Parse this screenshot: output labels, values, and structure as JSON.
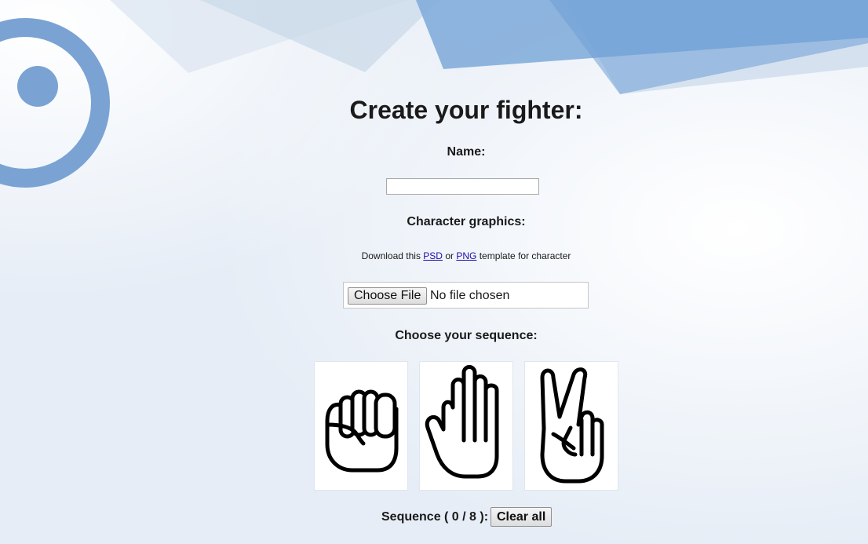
{
  "page": {
    "title": "Create your fighter:"
  },
  "form": {
    "name_label": "Name:",
    "name_value": "",
    "graphics_label": "Character graphics:",
    "download_prefix": "Download this",
    "psd_link": "PSD",
    "download_or": "or",
    "png_link": "PNG",
    "download_suffix": "template for character",
    "file_button_label": "Choose File",
    "file_status": "No file chosen",
    "sequence_label": "Choose your sequence:",
    "hands": [
      {
        "name": "rock",
        "icon": "fist-icon"
      },
      {
        "name": "paper",
        "icon": "open-hand-icon"
      },
      {
        "name": "scissors",
        "icon": "peace-sign-icon"
      }
    ],
    "sequence_status": "Sequence ( 0 / 8 ):",
    "sequence_count": 0,
    "sequence_max": 8,
    "clear_button_label": "Clear all"
  },
  "colors": {
    "accent_blue": "#6b9bd2",
    "background": "#eef3f9"
  }
}
